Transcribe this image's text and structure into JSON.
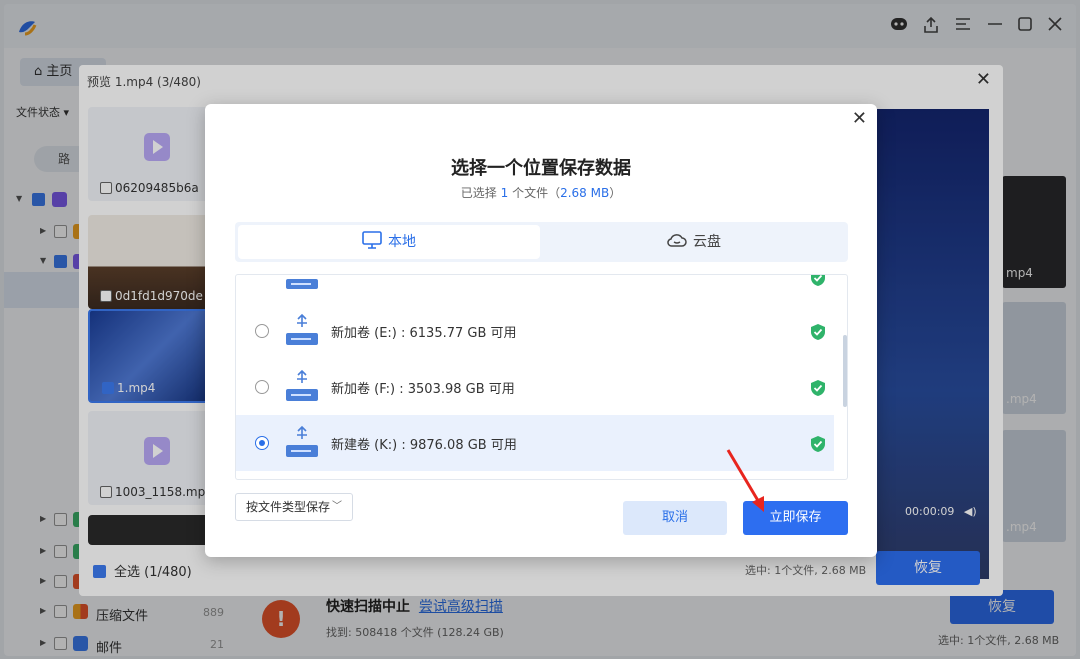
{
  "app": {
    "home_tab": "主页",
    "file_status": "文件状态 ▾",
    "path_button": "路",
    "tree": [
      {
        "label": "",
        "count": ""
      },
      {
        "label": "",
        "count": ""
      },
      {
        "label": "",
        "count": ""
      },
      {
        "label": "压缩文件",
        "count": "889"
      },
      {
        "label": "邮件",
        "count": "21"
      }
    ],
    "scan": {
      "title": "快速扫描中止",
      "link": "尝试高级扫描",
      "found": "找到: 508418 个文件 (128.24 GB)"
    },
    "recover_label": "恢复",
    "selected_info": "选中: 1个文件, 2.68 MB",
    "right_thumbs": [
      "mp4",
      ".mp4",
      ".mp4"
    ]
  },
  "preview": {
    "title": "预览 1.mp4 (3/480)",
    "thumbs": [
      {
        "name": "06209485b6a"
      },
      {
        "name": "0d1fd1d970de"
      },
      {
        "name": "1.mp4"
      },
      {
        "name": "1003_1158.mp4"
      }
    ],
    "select_all": "全选 (1/480)",
    "selected_info": "选中: 1个文件, 2.68 MB",
    "recover_label": "恢复",
    "video_time": "00:00:09"
  },
  "dialog": {
    "title": "选择一个位置保存数据",
    "subtitle_pre": "已选择",
    "subtitle_count": "1",
    "subtitle_mid": "个文件（",
    "subtitle_size": "2.68 MB",
    "subtitle_post": "）",
    "tabs": {
      "local": "本地",
      "cloud": "云盘"
    },
    "drives": [
      {
        "label": "新加卷 (E:) : 6135.77 GB 可用",
        "selected": false
      },
      {
        "label": "新加卷 (F:) : 3503.98 GB 可用",
        "selected": false
      },
      {
        "label": "新建卷 (K:) : 9876.08 GB 可用",
        "selected": true
      }
    ],
    "save_by_type": "按文件类型保存",
    "cancel": "取消",
    "save_now": "立即保存"
  },
  "colors": {
    "accent": "#2d6ef0",
    "ok_green": "#2fb36a",
    "annotation_red": "#e8251e"
  }
}
